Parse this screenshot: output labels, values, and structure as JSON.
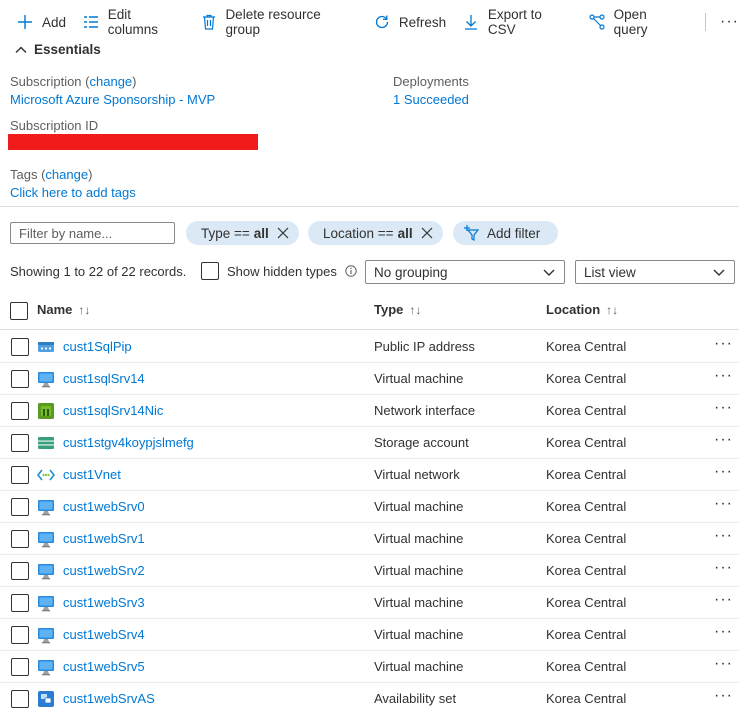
{
  "toolbar": {
    "add": "Add",
    "edit_columns": "Edit columns",
    "delete_group": "Delete resource group",
    "refresh": "Refresh",
    "export_csv": "Export to CSV",
    "open_query": "Open query",
    "more": "···"
  },
  "essentials": {
    "heading": "Essentials",
    "subscription_label": "Subscription",
    "change_link": "change",
    "subscription_value": "Microsoft Azure Sponsorship - MVP",
    "subscription_id_label": "Subscription ID",
    "deployments_label": "Deployments",
    "deployments_value": "1 Succeeded",
    "tags_label": "Tags",
    "tags_change": "change",
    "tags_value": "Click here to add tags"
  },
  "filters": {
    "name_placeholder": "Filter by name...",
    "type_prefix": "Type ==",
    "type_value": "all",
    "location_prefix": "Location ==",
    "location_value": "all",
    "add_filter": "Add filter"
  },
  "records": {
    "summary": "Showing 1 to 22 of 22 records.",
    "show_hidden": "Show hidden types",
    "grouping": "No grouping",
    "view": "List view"
  },
  "table": {
    "columns": {
      "name": "Name",
      "type": "Type",
      "location": "Location"
    },
    "rows": [
      {
        "name": "cust1SqlPip",
        "type": "Public IP address",
        "location": "Korea Central",
        "icon": "public-ip-icon"
      },
      {
        "name": "cust1sqlSrv14",
        "type": "Virtual machine",
        "location": "Korea Central",
        "icon": "vm-icon"
      },
      {
        "name": "cust1sqlSrv14Nic",
        "type": "Network interface",
        "location": "Korea Central",
        "icon": "nic-icon"
      },
      {
        "name": "cust1stgv4koypjslmefg",
        "type": "Storage account",
        "location": "Korea Central",
        "icon": "storage-icon"
      },
      {
        "name": "cust1Vnet",
        "type": "Virtual network",
        "location": "Korea Central",
        "icon": "vnet-icon"
      },
      {
        "name": "cust1webSrv0",
        "type": "Virtual machine",
        "location": "Korea Central",
        "icon": "vm-icon"
      },
      {
        "name": "cust1webSrv1",
        "type": "Virtual machine",
        "location": "Korea Central",
        "icon": "vm-icon"
      },
      {
        "name": "cust1webSrv2",
        "type": "Virtual machine",
        "location": "Korea Central",
        "icon": "vm-icon"
      },
      {
        "name": "cust1webSrv3",
        "type": "Virtual machine",
        "location": "Korea Central",
        "icon": "vm-icon"
      },
      {
        "name": "cust1webSrv4",
        "type": "Virtual machine",
        "location": "Korea Central",
        "icon": "vm-icon"
      },
      {
        "name": "cust1webSrv5",
        "type": "Virtual machine",
        "location": "Korea Central",
        "icon": "vm-icon"
      },
      {
        "name": "cust1webSrvAS",
        "type": "Availability set",
        "location": "Korea Central",
        "icon": "availability-set-icon"
      }
    ]
  },
  "colors": {
    "link": "#0078d4",
    "pill_bg": "#dbe9f7",
    "redaction": "#f21b1b"
  }
}
